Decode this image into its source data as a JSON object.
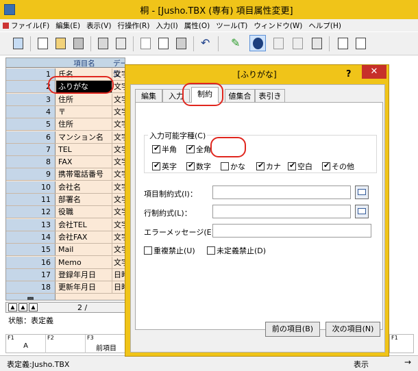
{
  "window": {
    "title": "桐 - [Jusho.TBX (専有) 項目属性変更]"
  },
  "menu": [
    "ファイル(F)",
    "編集(E)",
    "表示(V)",
    "行操作(R)",
    "入力(I)",
    "属性(O)",
    "ツール(T)",
    "ウィンドウ(W)",
    "ヘルプ(H)"
  ],
  "toolbar_icons": [
    "table-icon",
    "new-file-icon",
    "open-folder-icon",
    "save-icon",
    "print-icon",
    "preview-icon",
    "cut-icon",
    "copy-icon",
    "paste-icon",
    "undo-icon",
    "pencil-icon",
    "info-icon",
    "key-icon",
    "filter-icon",
    "sort-icon",
    "check-edit-icon",
    "check-edit2-icon"
  ],
  "grid": {
    "headers": [
      "項目名",
      "データ型"
    ],
    "rows": [
      {
        "num": "1",
        "name": "氏名",
        "type": "文字"
      },
      {
        "num": "2",
        "name": "ふりがな",
        "type": "文字"
      },
      {
        "num": "3",
        "name": "住所",
        "type": "文字"
      },
      {
        "num": "4",
        "name": "〒",
        "type": "文字"
      },
      {
        "num": "5",
        "name": "住所",
        "type": "文字"
      },
      {
        "num": "6",
        "name": "マンション名",
        "type": "文字"
      },
      {
        "num": "7",
        "name": "TEL",
        "type": "文字"
      },
      {
        "num": "8",
        "name": "FAX",
        "type": "文字"
      },
      {
        "num": "9",
        "name": "携帯電話番号",
        "type": "文字"
      },
      {
        "num": "10",
        "name": "会社名",
        "type": "文字"
      },
      {
        "num": "11",
        "name": "部署名",
        "type": "文字"
      },
      {
        "num": "12",
        "name": "役職",
        "type": "文字"
      },
      {
        "num": "13",
        "name": "会社TEL",
        "type": "文字"
      },
      {
        "num": "14",
        "name": "会社FAX",
        "type": "文字"
      },
      {
        "num": "15",
        "name": "Mail",
        "type": "文字"
      },
      {
        "num": "16",
        "name": "Memo",
        "type": "文字"
      },
      {
        "num": "17",
        "name": "登録年月日",
        "type": "日時"
      },
      {
        "num": "18",
        "name": "更新年月日",
        "type": "日時"
      }
    ],
    "new_row_marker": "▩",
    "page": "2 /"
  },
  "status": "状態：表定義",
  "fkeys": [
    {
      "key": "F1",
      "label": "A"
    },
    {
      "key": "F2",
      "label": ""
    },
    {
      "key": "F3",
      "label": "前項目"
    }
  ],
  "fkey_right": "F1",
  "bottombar": {
    "left": "表定義:Jusho.TBX",
    "right": "表示",
    "arrow": "→"
  },
  "dialog": {
    "title": "[ふりがな]",
    "help": "?",
    "close": "✕",
    "tabs": [
      "編集",
      "入力",
      "制約",
      "値集合",
      "表引き"
    ],
    "active_tab": "制約",
    "group_label": "入力可能字種(C)",
    "checks_row1": [
      {
        "label": "半角",
        "checked": true
      },
      {
        "label": "全角",
        "checked": true
      }
    ],
    "checks_row2": [
      {
        "label": "英字",
        "checked": true
      },
      {
        "label": "数字",
        "checked": true
      },
      {
        "label": "かな",
        "checked": false
      },
      {
        "label": "カナ",
        "checked": true
      },
      {
        "label": "空白",
        "checked": true
      },
      {
        "label": "その他",
        "checked": true
      }
    ],
    "field_item_constraint": "項目制約式(I)：",
    "field_row_constraint": "行制約式(L)：",
    "field_error_message": "エラーメッセージ(E)：",
    "check_no_duplicate": {
      "label": "重複禁止(U)",
      "checked": false
    },
    "check_no_undefined": {
      "label": "未定義禁止(D)",
      "checked": false
    },
    "btn_prev": "前の項目(B)",
    "btn_next": "次の項目(N)"
  },
  "colors": {
    "titlebar": "#f0c419",
    "close": "#c7302a",
    "highlight": "#e0261e",
    "grid_bg": "#fbe9d7",
    "rownum_bg": "#c5d6e8"
  }
}
